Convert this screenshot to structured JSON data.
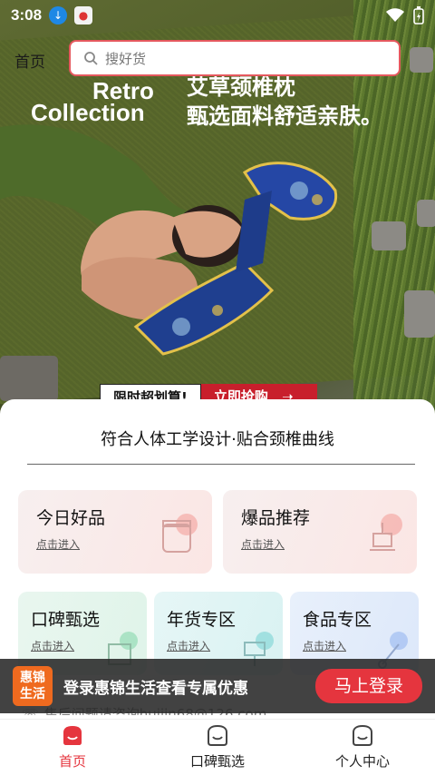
{
  "status_bar": {
    "time": "3:08"
  },
  "header": {
    "home_label": "首页",
    "search_placeholder": "搜好货"
  },
  "banner": {
    "brand_line1": "Retro",
    "brand_line2": "Collection",
    "headline_line1": "艾草颈椎枕",
    "headline_line2": "甄选面料舒适亲肤。",
    "badge_deal": "限时超划算!",
    "badge_buy": "立即抢购"
  },
  "slogan": "符合人体工学设计·贴合颈椎曲线",
  "tiles": [
    {
      "title": "今日好品",
      "sub": "点击进入",
      "icon": "jar-icon"
    },
    {
      "title": "爆品推荐",
      "sub": "点击进入",
      "icon": "scale-icon"
    },
    {
      "title": "口碑甄选",
      "sub": "点击进入",
      "icon": "box-icon"
    },
    {
      "title": "年货专区",
      "sub": "点击进入",
      "icon": "lamp-icon"
    },
    {
      "title": "食品专区",
      "sub": "点击进入",
      "icon": "tool-icon"
    }
  ],
  "login_bar": {
    "logo_line1": "惠锦",
    "logo_line2": "生活",
    "text": "登录惠锦生活查看专属优惠",
    "button": "马上登录",
    "footer_partial": "售后问题请咨询huijin68@126.com"
  },
  "tabbar": [
    {
      "label": "首页",
      "active": true
    },
    {
      "label": "口碑甄选",
      "active": false
    },
    {
      "label": "个人中心",
      "active": false
    }
  ],
  "colors": {
    "accent": "#e5353e",
    "banner_red": "#c81f2c",
    "logo_orange": "#ef6a1f"
  }
}
